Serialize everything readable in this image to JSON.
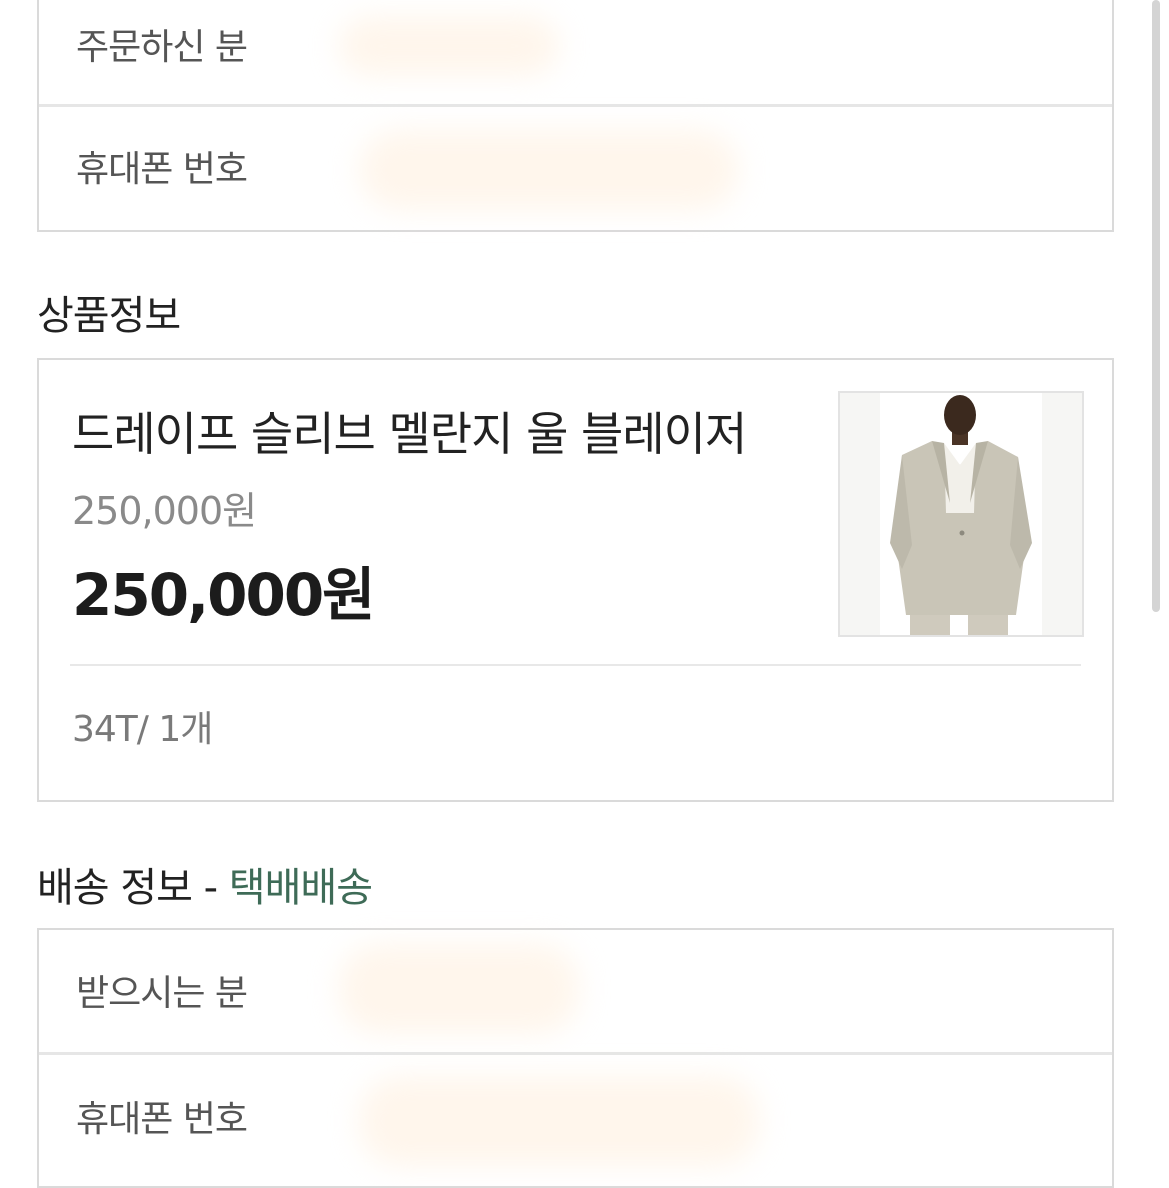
{
  "orderer": {
    "name_label": "주문하신 분",
    "phone_label": "휴대폰 번호"
  },
  "product_section": {
    "title": "상품정보",
    "product": {
      "name": "드레이프 슬리브 멜란지 울 블레이저",
      "original_price": "250,000원",
      "final_price": "250,000원",
      "option": "34T/ 1개",
      "image_icon": "product-photo-blazer"
    }
  },
  "shipping_section": {
    "title": "배송 정보",
    "separator": " - ",
    "method": "택배배송",
    "recipient_label": "받으시는 분",
    "phone_label": "휴대폰 번호"
  },
  "colors": {
    "accent": "#3e6b57",
    "border": "#dadada",
    "muted_text": "#8a8a8a"
  }
}
